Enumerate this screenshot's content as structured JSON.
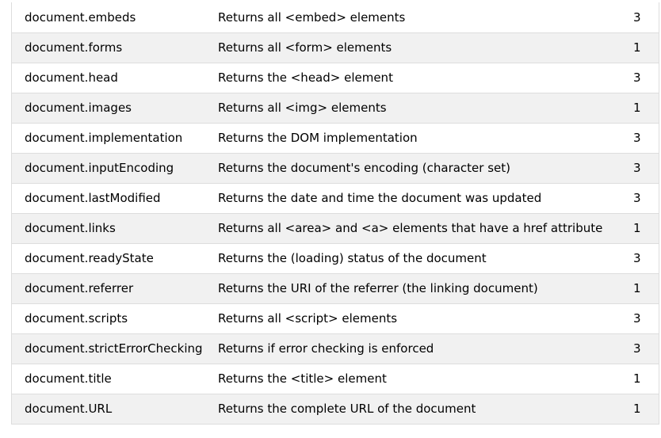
{
  "table": {
    "rows": [
      {
        "property": "document.embeds",
        "description": "Returns all <embed> elements",
        "level": "3"
      },
      {
        "property": "document.forms",
        "description": "Returns all <form> elements",
        "level": "1"
      },
      {
        "property": "document.head",
        "description": "Returns the <head> element",
        "level": "3"
      },
      {
        "property": "document.images",
        "description": "Returns all <img> elements",
        "level": "1"
      },
      {
        "property": "document.implementation",
        "description": "Returns the DOM implementation",
        "level": "3"
      },
      {
        "property": "document.inputEncoding",
        "description": "Returns the document's encoding (character set)",
        "level": "3"
      },
      {
        "property": "document.lastModified",
        "description": "Returns the date and time the document was updated",
        "level": "3"
      },
      {
        "property": "document.links",
        "description": "Returns all <area> and <a> elements that have a href attribute",
        "level": "1"
      },
      {
        "property": "document.readyState",
        "description": "Returns the (loading) status of the document",
        "level": "3"
      },
      {
        "property": "document.referrer",
        "description": "Returns the URI of the referrer (the linking document)",
        "level": "1"
      },
      {
        "property": "document.scripts",
        "description": "Returns all <script> elements",
        "level": "3"
      },
      {
        "property": "document.strictErrorChecking",
        "description": "Returns if error checking is enforced",
        "level": "3"
      },
      {
        "property": "document.title",
        "description": "Returns the <title> element",
        "level": "1"
      },
      {
        "property": "document.URL",
        "description": "Returns the complete URL of the document",
        "level": "1"
      }
    ]
  }
}
